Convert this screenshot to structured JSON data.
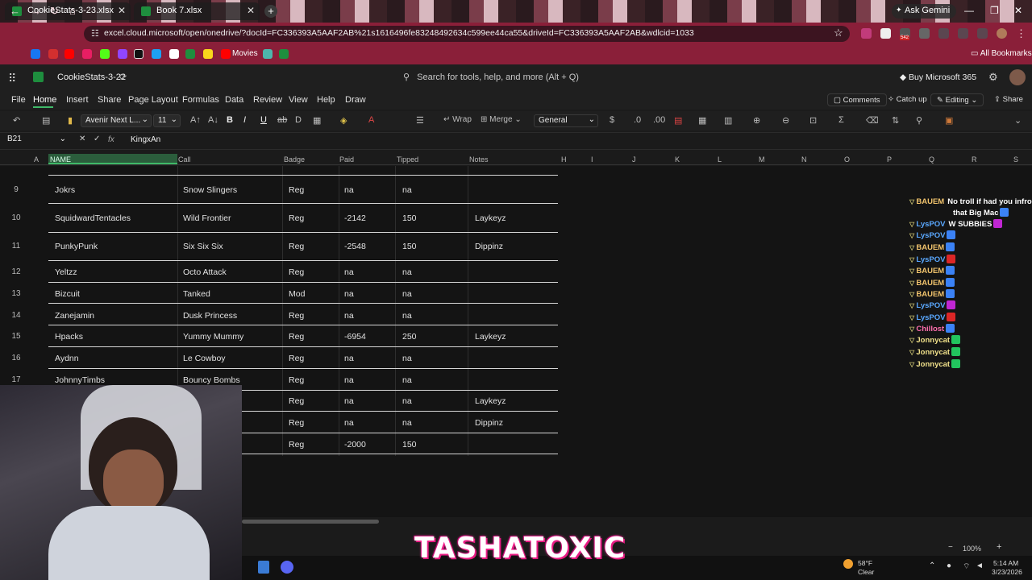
{
  "browser": {
    "tabs": [
      {
        "label": "CookieStats-3-23.xlsx"
      },
      {
        "label": "Book 7.xlsx"
      }
    ],
    "ask_gemini": "Ask Gemini",
    "url": "excel.cloud.microsoft/open/onedrive/?docId=FC336393A5AAF2AB%21s1616496fe83248492634c599ee44ca55&driveId=FC336393A5AAF2AB&wdlcid=1033",
    "bookmarks": {
      "movies": "Movies",
      "all": "All Bookmarks"
    },
    "ext_badge": "542"
  },
  "excel": {
    "file_name": "CookieStats-3-22",
    "search_placeholder": "Search for tools, help, and more (Alt + Q)",
    "buy": "Buy Microsoft 365",
    "tabs": [
      "File",
      "Home",
      "Insert",
      "Share",
      "Page Layout",
      "Formulas",
      "Data",
      "Review",
      "View",
      "Help",
      "Draw"
    ],
    "actions": {
      "comments": "Comments",
      "catchup": "Catch up",
      "editing": "Editing",
      "share": "Share"
    },
    "font_name": "Avenir Next L...",
    "font_size": "11",
    "wrap": "Wrap",
    "merge": "Merge",
    "number_format": "General",
    "name_box": "B21",
    "formula": "KingxAn",
    "col_letters": [
      "A",
      "NAME",
      "Call",
      "Badge",
      "Paid",
      "Tipped",
      "Notes",
      "H",
      "I",
      "J",
      "K",
      "L",
      "M",
      "N",
      "O",
      "P",
      "Q",
      "R",
      "S"
    ],
    "rows": [
      {
        "num": "9",
        "name": "Jokrs",
        "call": "Snow Slingers",
        "badge": "Reg",
        "paid": "na",
        "tipped": "na",
        "notes": ""
      },
      {
        "num": "10",
        "name": "SquidwardTentacles",
        "call": "Wild Frontier",
        "badge": "Reg",
        "paid": "-2142",
        "tipped": "150",
        "notes": "Laykeyz"
      },
      {
        "num": "11",
        "name": "PunkyPunk",
        "call": "Six Six Six",
        "badge": "Reg",
        "paid": "-2548",
        "tipped": "150",
        "notes": "Dippinz"
      },
      {
        "num": "12",
        "name": "Yeltzz",
        "call": "Octo Attack",
        "badge": "Reg",
        "paid": "na",
        "tipped": "na",
        "notes": ""
      },
      {
        "num": "13",
        "name": "Bizcuit",
        "call": "Tanked",
        "badge": "Mod",
        "paid": "na",
        "tipped": "na",
        "notes": ""
      },
      {
        "num": "14",
        "name": "Zanejamin",
        "call": "Dusk Princess",
        "badge": "Reg",
        "paid": "na",
        "tipped": "na",
        "notes": ""
      },
      {
        "num": "15",
        "name": "Hpacks",
        "call": "Yummy Mummy",
        "badge": "Reg",
        "paid": "-6954",
        "tipped": "250",
        "notes": "Laykeyz"
      },
      {
        "num": "16",
        "name": "Aydnn",
        "call": "Le Cowboy",
        "badge": "Reg",
        "paid": "na",
        "tipped": "na",
        "notes": ""
      },
      {
        "num": "17",
        "name": "JohnnyTimbs",
        "call": "Bouncy Bombs",
        "badge": "Reg",
        "paid": "na",
        "tipped": "na",
        "notes": ""
      },
      {
        "num": "",
        "name": "",
        "call": "",
        "badge": "Reg",
        "paid": "na",
        "tipped": "na",
        "notes": "Laykeyz"
      },
      {
        "num": "",
        "name": "",
        "call": "",
        "badge": "Reg",
        "paid": "na",
        "tipped": "na",
        "notes": "Dippinz"
      },
      {
        "num": "",
        "name": "",
        "call": "",
        "badge": "Reg",
        "paid": "-2000",
        "tipped": "150",
        "notes": ""
      }
    ],
    "zoom": "100%"
  },
  "chat": [
    {
      "user": "BAUEM",
      "msg": "No troll if had you infro",
      "color": "#f2c46d"
    },
    {
      "user": "",
      "msg": "that Big Mac",
      "color": "#ffffff"
    },
    {
      "user": "LysPOV",
      "msg": "W SUBBIES",
      "color": "#5aa8ff"
    },
    {
      "user": "LysPOV",
      "msg": "",
      "color": "#5aa8ff"
    },
    {
      "user": "BAUEM",
      "msg": "",
      "color": "#f2c46d"
    },
    {
      "user": "LysPOV",
      "msg": "",
      "color": "#5aa8ff"
    },
    {
      "user": "BAUEM",
      "msg": "",
      "color": "#f2c46d"
    },
    {
      "user": "BAUEM",
      "msg": "",
      "color": "#f2c46d"
    },
    {
      "user": "BAUEM",
      "msg": "",
      "color": "#f2c46d"
    },
    {
      "user": "LysPOV",
      "msg": "",
      "color": "#5aa8ff"
    },
    {
      "user": "LysPOV",
      "msg": "",
      "color": "#5aa8ff"
    },
    {
      "user": "Chillost",
      "msg": "",
      "color": "#ff6fae"
    },
    {
      "user": "Jonnycat",
      "msg": "",
      "color": "#f0e08a"
    },
    {
      "user": "Jonnycat",
      "msg": "",
      "color": "#f0e08a"
    },
    {
      "user": "Jonnycat",
      "msg": "",
      "color": "#f0e08a"
    }
  ],
  "overlay": {
    "logo": "TASHATOXIC"
  },
  "taskbar": {
    "weather_temp": "58°F",
    "weather_desc": "Clear",
    "time": "5:14 AM",
    "date": "3/23/2026"
  },
  "colors": {
    "accent": "#3fb968",
    "browser_frame": "#8a1f39"
  }
}
